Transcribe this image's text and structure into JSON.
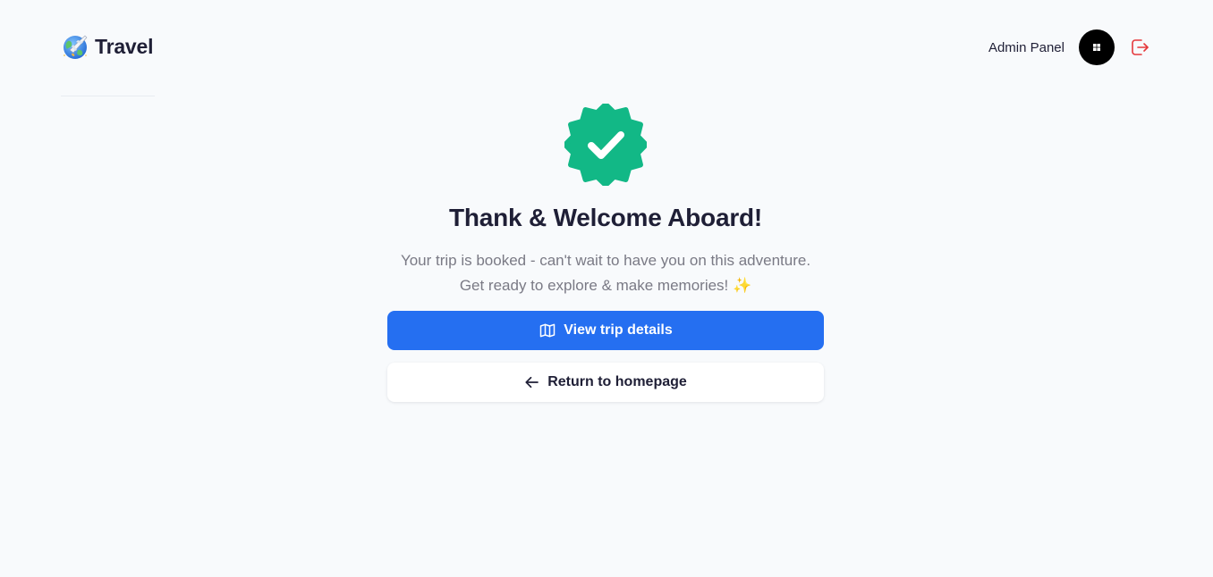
{
  "header": {
    "logo_text": "Travel",
    "admin_link": "Admin Panel",
    "avatar_icon": "windows-logo-icon",
    "logout_icon": "logout-icon",
    "logout_color": "#e5383b"
  },
  "main": {
    "badge_icon": "verified-check-badge-icon",
    "badge_color": "#12b886",
    "title": "Thank & Welcome Aboard!",
    "subtitle": "Your trip is booked - can't wait to have you on this adventure. Get ready to explore & make memories! ✨",
    "primary_button": {
      "label": "View trip details",
      "icon": "map-icon",
      "color": "#256ff1"
    },
    "secondary_button": {
      "label": "Return to homepage",
      "icon": "arrow-left-icon"
    }
  }
}
